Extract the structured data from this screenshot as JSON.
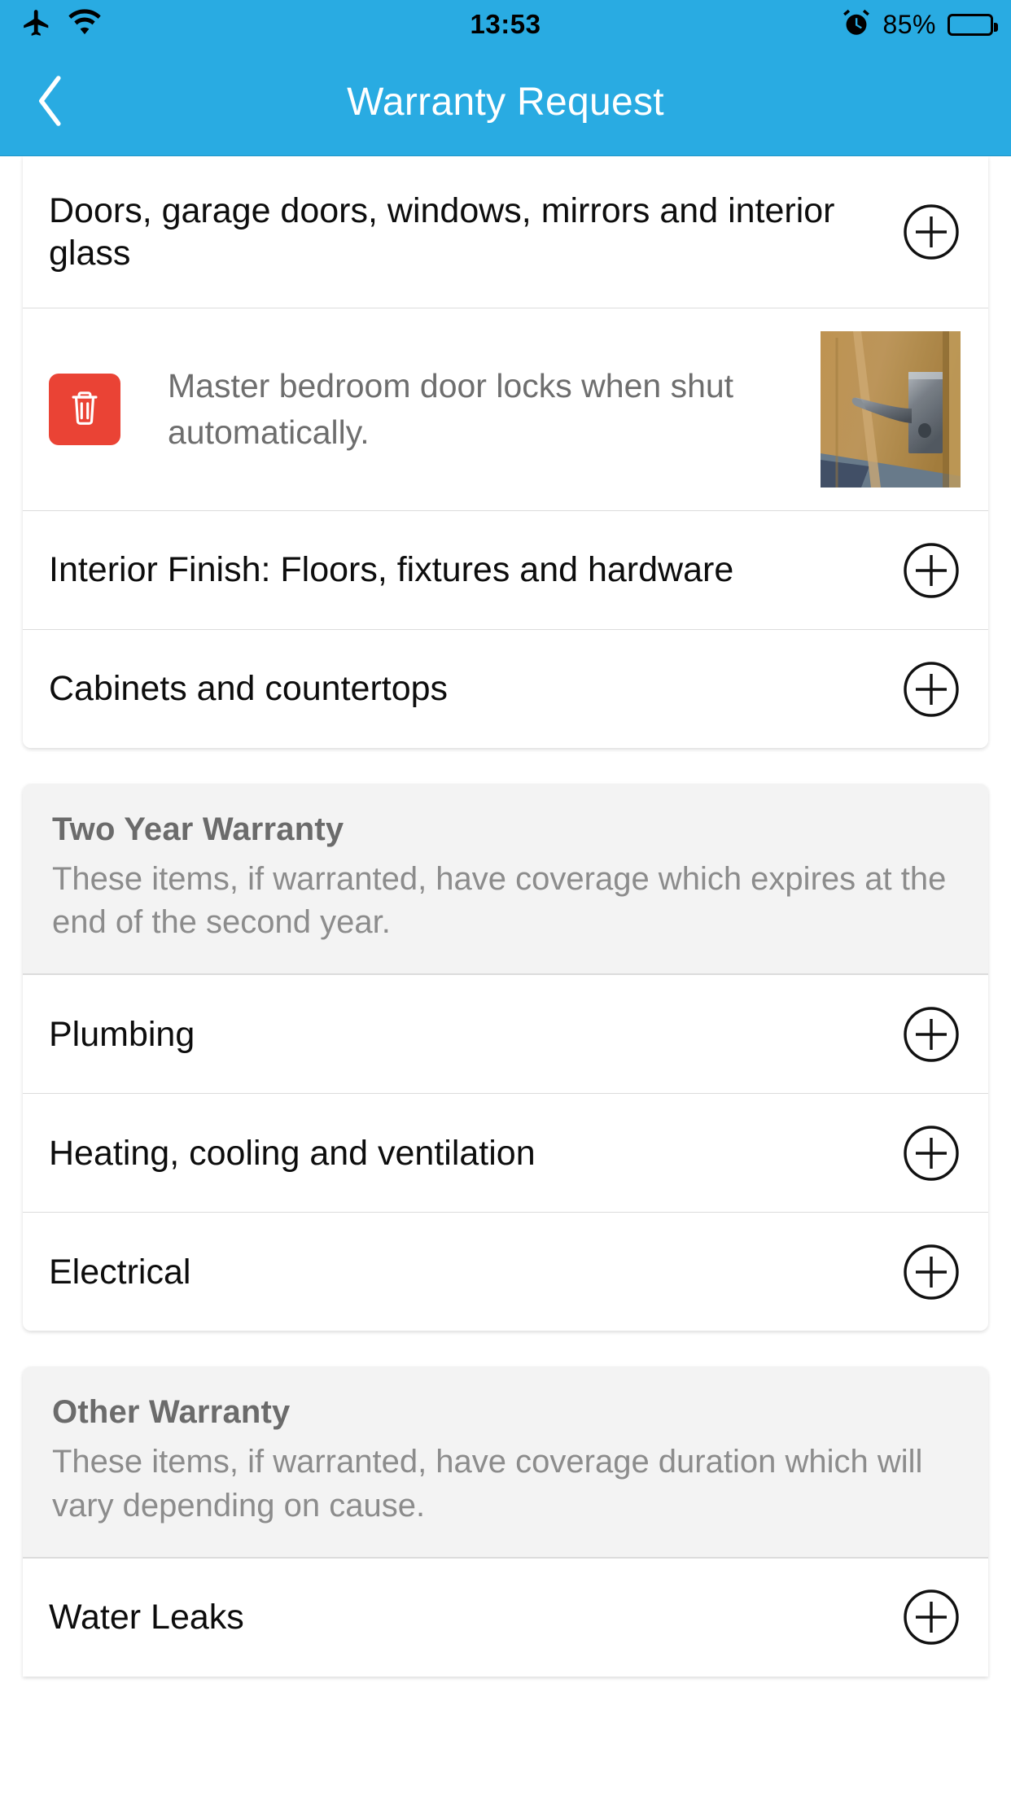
{
  "status_bar": {
    "airplane_icon": "airplane-mode-icon",
    "wifi_icon": "wifi-icon",
    "time": "13:53",
    "alarm_icon": "alarm-clock-icon",
    "battery_percent": "85%",
    "battery_level": 85,
    "background_color": "#29ABE2",
    "foreground_color": "#000000"
  },
  "nav_bar": {
    "back_icon": "back-chevron-icon",
    "title": "Warranty Request",
    "background_color": "#29ABE2",
    "title_color": "#FFFFFF"
  },
  "sections": [
    {
      "id": "one-year-continued",
      "header": null,
      "rows": [
        {
          "type": "category",
          "label": "Doors, garage doors, windows, mirrors and interior glass",
          "action_icon": "plus-circle-icon"
        },
        {
          "type": "complaint",
          "delete_icon": "trash-icon",
          "delete_color": "#EA4335",
          "text": "Master bedroom door locks when shut automatically.",
          "thumbnail_alt": "door-handle-photo"
        },
        {
          "type": "category",
          "label": "Interior Finish: Floors, fixtures and hardware",
          "action_icon": "plus-circle-icon"
        },
        {
          "type": "category",
          "label": "Cabinets and countertops",
          "action_icon": "plus-circle-icon"
        }
      ]
    },
    {
      "id": "two-year-warranty",
      "header": {
        "title": "Two Year Warranty",
        "description": "These items, if warranted, have coverage which expires at the end of the second year."
      },
      "rows": [
        {
          "type": "category",
          "label": "Plumbing",
          "action_icon": "plus-circle-icon"
        },
        {
          "type": "category",
          "label": "Heating, cooling and ventilation",
          "action_icon": "plus-circle-icon"
        },
        {
          "type": "category",
          "label": "Electrical",
          "action_icon": "plus-circle-icon"
        }
      ]
    },
    {
      "id": "other-warranty",
      "header": {
        "title": "Other Warranty",
        "description": "These items, if warranted, have coverage duration which will vary depending on cause."
      },
      "rows": [
        {
          "type": "category",
          "label": "Water Leaks",
          "action_icon": "plus-circle-icon"
        }
      ]
    }
  ]
}
